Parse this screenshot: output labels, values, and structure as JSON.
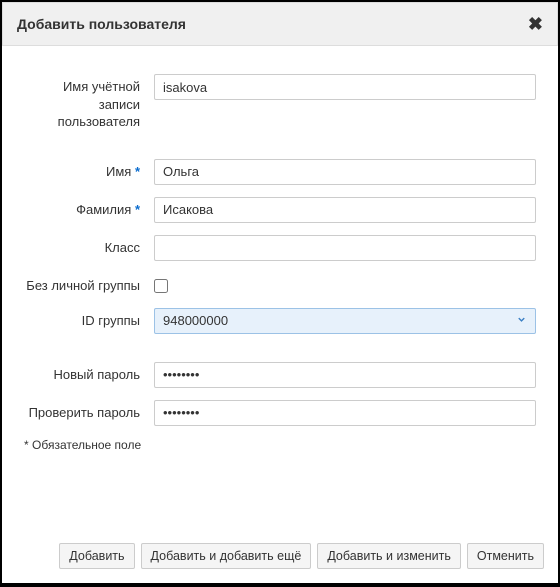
{
  "dialog": {
    "title": "Добавить пользователя"
  },
  "fields": {
    "login_label": "Имя учётной записи пользователя",
    "login_value": "isakova",
    "firstname_label": "Имя",
    "firstname_value": "Ольга",
    "lastname_label": "Фамилия",
    "lastname_value": "Исакова",
    "class_label": "Класс",
    "class_value": "",
    "noprivgroup_label": "Без личной группы",
    "noprivgroup_checked": false,
    "gid_label": "ID группы",
    "gid_value": "948000000",
    "newpass_label": "Новый пароль",
    "newpass_value": "••••••••",
    "verifypass_label": "Проверить пароль",
    "verifypass_value": "••••••••"
  },
  "required_marker": "*",
  "footnote": "* Обязательное поле",
  "buttons": {
    "add": "Добавить",
    "add_another": "Добавить и добавить ещё",
    "add_edit": "Добавить и изменить",
    "cancel": "Отменить"
  }
}
